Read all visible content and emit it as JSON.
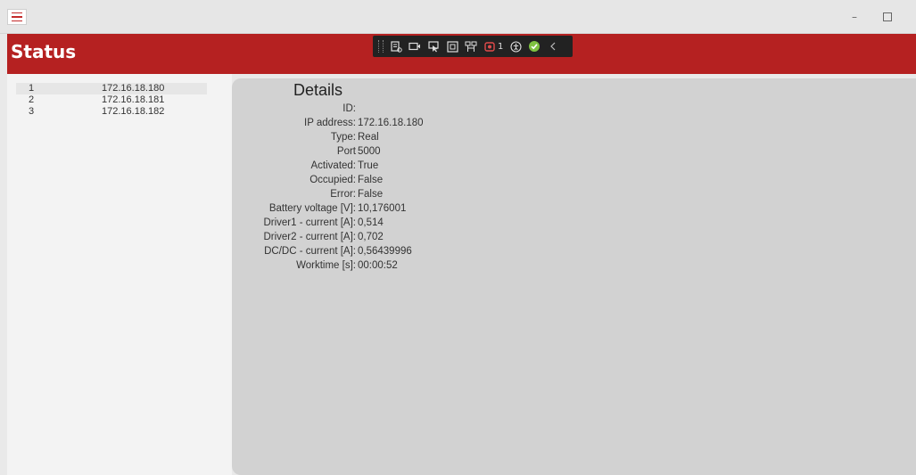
{
  "window": {
    "title": "Status",
    "minimize_label": "–",
    "menu_icon": "hamburger-icon",
    "maximize_icon": "maximize-icon"
  },
  "header": {
    "title": "Status",
    "background_color": "#b52121"
  },
  "debug_toolbar": {
    "icons": [
      "live-visual-tree-icon",
      "video-icon",
      "select-element-icon",
      "display-layout-adorners-icon",
      "track-focus-icon",
      "binding-failures-icon",
      "accessibility-icon",
      "hot-reload-ok-icon",
      "collapse-chevron-icon"
    ],
    "binding_failures_count": "1"
  },
  "devices": [
    {
      "id": "1",
      "ip": "172.16.18.180",
      "selected": true
    },
    {
      "id": "2",
      "ip": "172.16.18.181",
      "selected": false
    },
    {
      "id": "3",
      "ip": "172.16.18.182",
      "selected": false
    }
  ],
  "details": {
    "title": "Details",
    "fields": [
      {
        "label": "ID:",
        "value": ""
      },
      {
        "label": "IP address:",
        "value": "172.16.18.180"
      },
      {
        "label": "Type:",
        "value": "Real"
      },
      {
        "label": "Port",
        "value": "5000"
      },
      {
        "label": "Activated:",
        "value": "True"
      },
      {
        "label": "Occupied:",
        "value": "False"
      },
      {
        "label": "Error:",
        "value": "False"
      },
      {
        "label": "Battery voltage [V]:",
        "value": "10,176001"
      },
      {
        "label": "Driver1 - current [A]:",
        "value": "0,514"
      },
      {
        "label": "Driver2 - current [A]:",
        "value": "0,702"
      },
      {
        "label": "DC/DC - current [A]:",
        "value": "0,56439996"
      },
      {
        "label": "Worktime [s]:",
        "value": "00:00:52"
      }
    ]
  }
}
